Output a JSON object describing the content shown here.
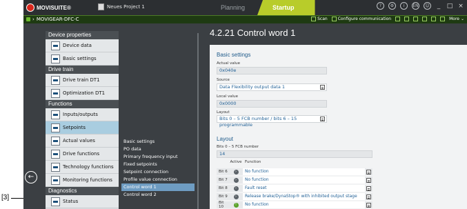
{
  "callout": {
    "label": "[3]"
  },
  "titlebar": {
    "brand": "MOVISUITE®",
    "project": "Neues Project 1",
    "modes": [
      "Planning",
      "Startup"
    ],
    "active_mode": "Startup",
    "window_controls": [
      "_",
      "□",
      "×"
    ]
  },
  "devicebar": {
    "device": "MOVIGEAR-DFC-C",
    "scan": "Scan",
    "configure": "Configure communication",
    "more": "More"
  },
  "nav": {
    "categories": [
      {
        "label": "Device properties",
        "items": [
          "Device data",
          "Basic settings"
        ]
      },
      {
        "label": "Drive train",
        "items": [
          "Drive train DT1",
          "Optimization DT1"
        ]
      },
      {
        "label": "Functions",
        "items": [
          "Inputs/outputs",
          "Setpoints",
          "Actual values",
          "Drive functions",
          "Technology functions",
          "Monitoring functions"
        ]
      },
      {
        "label": "Diagnostics",
        "items": [
          "Status"
        ]
      }
    ],
    "active_item": "Setpoints"
  },
  "subnav": {
    "items": [
      "Basic settings",
      "PO data",
      "Primary frequency input",
      "Fixed setpoints",
      "Setpoint connection",
      "Profile value connection",
      "Control word 1",
      "Control word 2"
    ],
    "active_item": "Control word 1"
  },
  "page": {
    "title": "4.2.21 Control word 1",
    "basic_settings": {
      "title": "Basic settings",
      "actual_value_label": "Actual value",
      "actual_value": "0x040e",
      "source_label": "Source",
      "source": "Data Flexibility output data 1",
      "local_value_label": "Local value",
      "local_value": "0x0000",
      "layout_label": "Layout",
      "layout": "Bits 0 – 5 FCB number / bits 6 – 15 programmable"
    },
    "layout_section": {
      "title": "Layout",
      "fcb_label": "Bits 0 – 5 FCB number",
      "fcb_value": "14",
      "col_active": "Active",
      "col_function": "Function",
      "rows": [
        {
          "bit": "Bit 6",
          "active": false,
          "function": "No function"
        },
        {
          "bit": "Bit 7",
          "active": false,
          "function": "No function"
        },
        {
          "bit": "Bit 8",
          "active": false,
          "function": "Fault reset"
        },
        {
          "bit": "Bit 9",
          "active": false,
          "function": "Release brake/DynaStop® with inhibited output stage"
        },
        {
          "bit": "Bit 10",
          "active": true,
          "function": "No function"
        }
      ]
    }
  },
  "colors": {
    "startup_accent": "#b8cc2a",
    "selection": "#a9cde0",
    "link_blue": "#1f5f95",
    "brand_red": "#d9261c"
  }
}
